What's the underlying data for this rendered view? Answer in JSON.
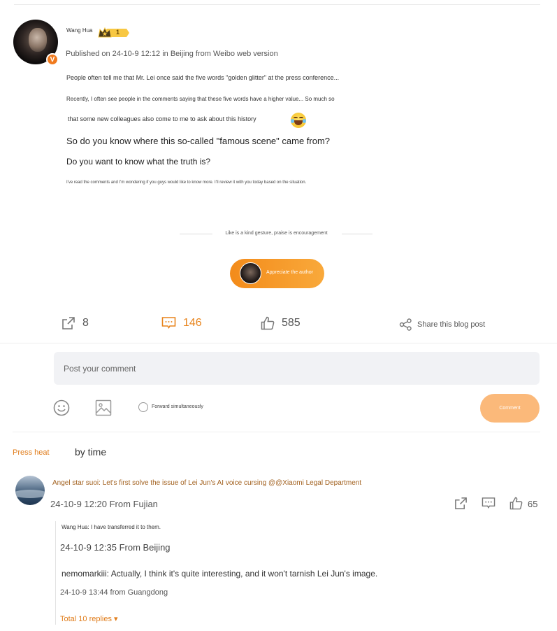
{
  "post": {
    "author": "Wang Hua",
    "level": "1",
    "meta": "Published on 24-10-9 12:12 in Beijing from Weibo web version",
    "paragraphs": [
      "People often tell me that Mr. Lei once said the five words \"golden glitter\" at the press conference...",
      "Recently, I often see people in the comments saying that these five words have a higher value... So much so",
      "that some new colleagues also come to me to ask about this history",
      "So do you know where this so-called \"famous scene\" came from?",
      "Do you want to know what the truth is?",
      "I've read the comments and I'm wondering if you guys would like to know more. I'll review it with you today based on the situation."
    ],
    "emoji": "laughing-crying-emoji",
    "encourage_text": "Like is a kind gesture, praise is encouragement",
    "appreciate_label": "Appreciate the author"
  },
  "actions": {
    "reposts": "8",
    "comments": "146",
    "likes": "585",
    "share_label": "Share this blog post"
  },
  "composer": {
    "placeholder": "Post your comment",
    "forward_label": "Forward simultaneously",
    "submit_label": "Comment"
  },
  "sort": {
    "heat_label": "Press heat",
    "time_label": "by time"
  },
  "comment": {
    "text": "Angel star suoi: Let's first solve the issue of Lei Jun's AI voice cursing @@Xiaomi Legal Department",
    "meta": "24-10-9 12:20 From Fujian",
    "likes": "65",
    "replies": [
      {
        "text": "Wang Hua: I have transferred it to them.",
        "meta": "24-10-9 12:35 From Beijing"
      },
      {
        "text": "nemomarkiii: Actually, I think it's quite interesting, and it won't tarnish Lei Jun's image.",
        "meta": "24-10-9 13:44 from Guangdong"
      }
    ],
    "total_replies": "Total 10 replies ▾"
  },
  "colors": {
    "accent": "#e8841c",
    "button_orange": "#f38b1a",
    "input_bg": "#f1f2f5",
    "comment_name": "#a2611f"
  }
}
